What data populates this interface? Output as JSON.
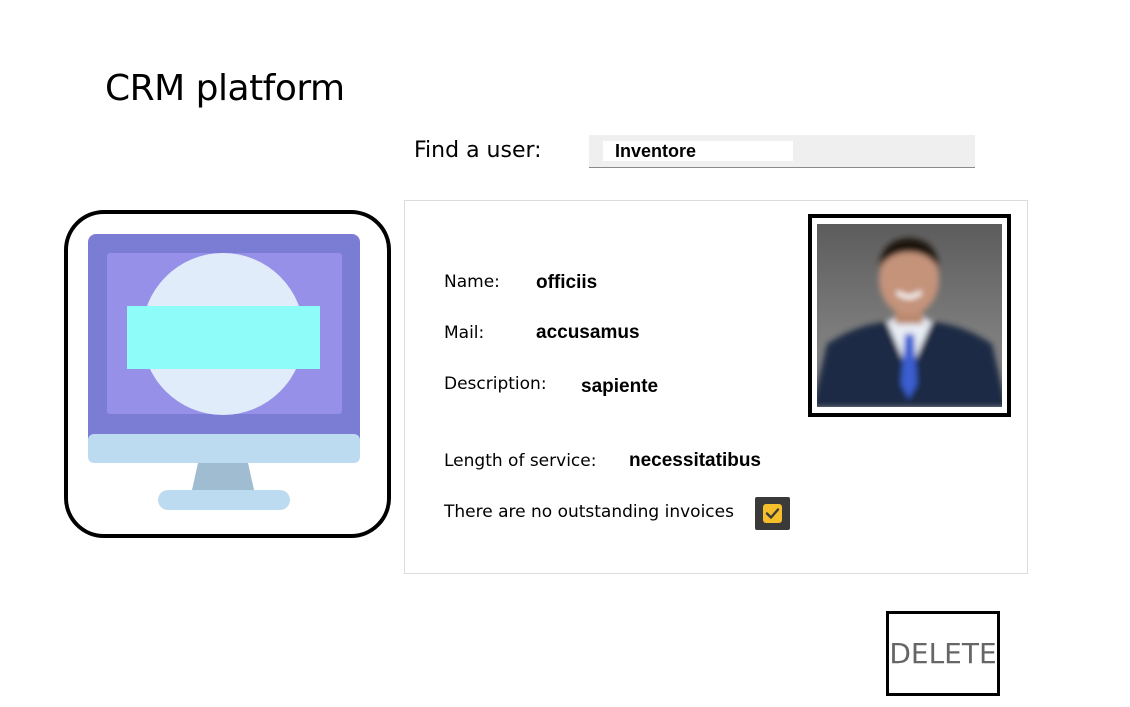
{
  "app": {
    "title": "CRM platform"
  },
  "search": {
    "label": "Find a user:",
    "value": "Inventore"
  },
  "user": {
    "name_label": "Name:",
    "name_value": "officiis",
    "mail_label": "Mail:",
    "mail_value": "accusamus",
    "description_label": "Description:",
    "description_value": "sapiente",
    "service_label": "Length of service:",
    "service_value": "necessitatibus",
    "invoices_label": "There are no outstanding invoices",
    "invoices_checked": true
  },
  "actions": {
    "delete_label": "DELETE"
  },
  "icons": {
    "monitor": "desktop-monitor-icon",
    "checkbox": "check-icon"
  },
  "colors": {
    "monitor_frame": "#7b7dd4",
    "monitor_screen": "#9690e8",
    "monitor_circle": "#e1ecfa",
    "monitor_bar": "#8efcf8",
    "monitor_base": "#bddbf0",
    "monitor_stand": "#a0bcd0",
    "checkbox_fill": "#f4bf2a"
  }
}
